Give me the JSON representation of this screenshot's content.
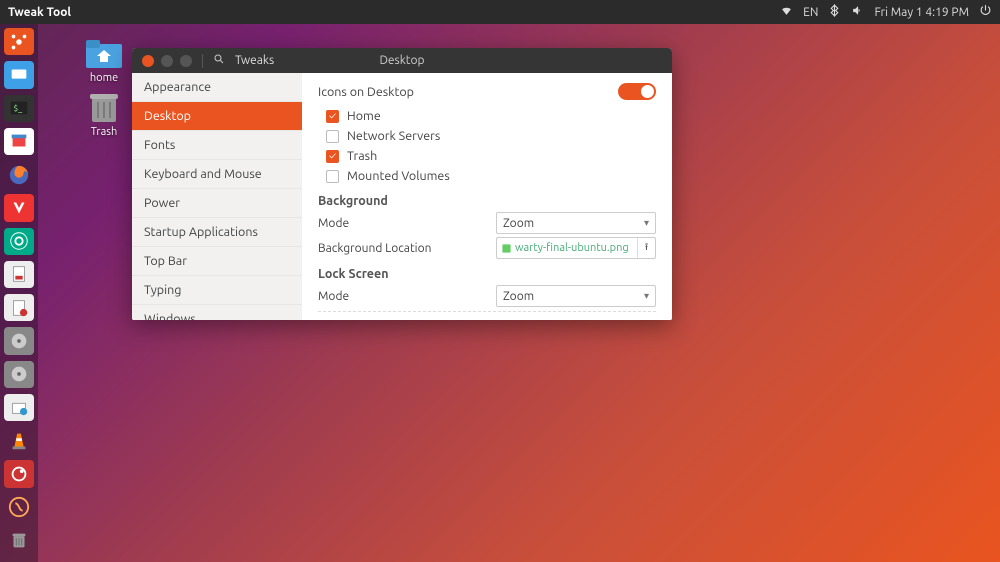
{
  "topbar": {
    "title": "Tweak Tool",
    "lang": "EN",
    "clock": "Fri May  1  4:19 PM"
  },
  "desktop": {
    "home_label": "home",
    "trash_label": "Trash"
  },
  "window": {
    "app_name": "Tweaks",
    "header_title": "Desktop",
    "sidebar": [
      "Appearance",
      "Desktop",
      "Fonts",
      "Keyboard and Mouse",
      "Power",
      "Startup Applications",
      "Top Bar",
      "Typing",
      "Windows"
    ],
    "sidebar_active": 1,
    "content": {
      "icons_title": "Icons on Desktop",
      "icons_toggle": true,
      "checks": [
        {
          "label": "Home",
          "on": true
        },
        {
          "label": "Network Servers",
          "on": false
        },
        {
          "label": "Trash",
          "on": true
        },
        {
          "label": "Mounted Volumes",
          "on": false
        }
      ],
      "bg_section": "Background",
      "mode_label": "Mode",
      "bg_mode": "Zoom",
      "bg_loc_label": "Background Location",
      "bg_file": "warty-final-ubuntu.png",
      "lock_section": "Lock Screen",
      "lock_mode": "Zoom"
    }
  }
}
